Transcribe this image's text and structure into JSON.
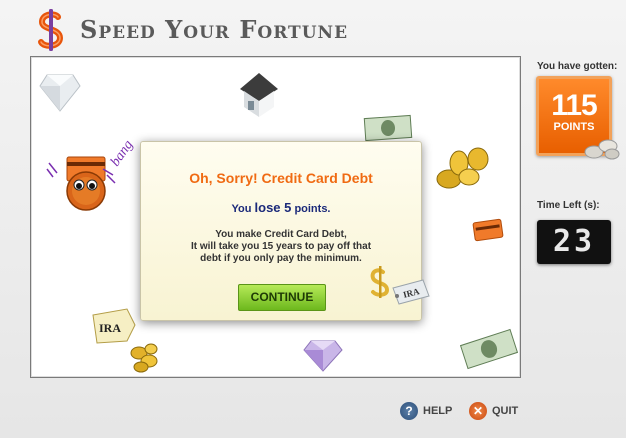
{
  "header": {
    "title": "Speed Your Fortune",
    "logo_icon": "dollar-sign-logo-icon",
    "brand_color": "#e8550b"
  },
  "field": {
    "bang_text": "bang",
    "ira_label_top": "IRA",
    "ira_label_bottom": "IRA",
    "items": [
      "diamond-icon",
      "house-icon",
      "money-bill-icon",
      "gold-coins-icon",
      "credit-card-icon",
      "player-avatar-icon",
      "ira-tag-icon",
      "purple-diamond-icon",
      "dollar-tag-icon"
    ]
  },
  "dialog": {
    "title": "Oh, Sorry! Credit Card Debt",
    "points_prefix": "You",
    "points_value": "lose 5",
    "points_suffix": "points.",
    "message_lines": [
      "You make Credit Card Debt,",
      "It will take you 15 years to pay off that",
      "debt if you only pay the minimum."
    ],
    "continue_label": "CONTINUE"
  },
  "side": {
    "score_label": "You have gotten:",
    "score_value": "115",
    "score_unit": "POINTS",
    "time_label": "Time Left (s):",
    "time_value": "23"
  },
  "footer": {
    "help_label": "HELP",
    "quit_label": "QUIT"
  }
}
